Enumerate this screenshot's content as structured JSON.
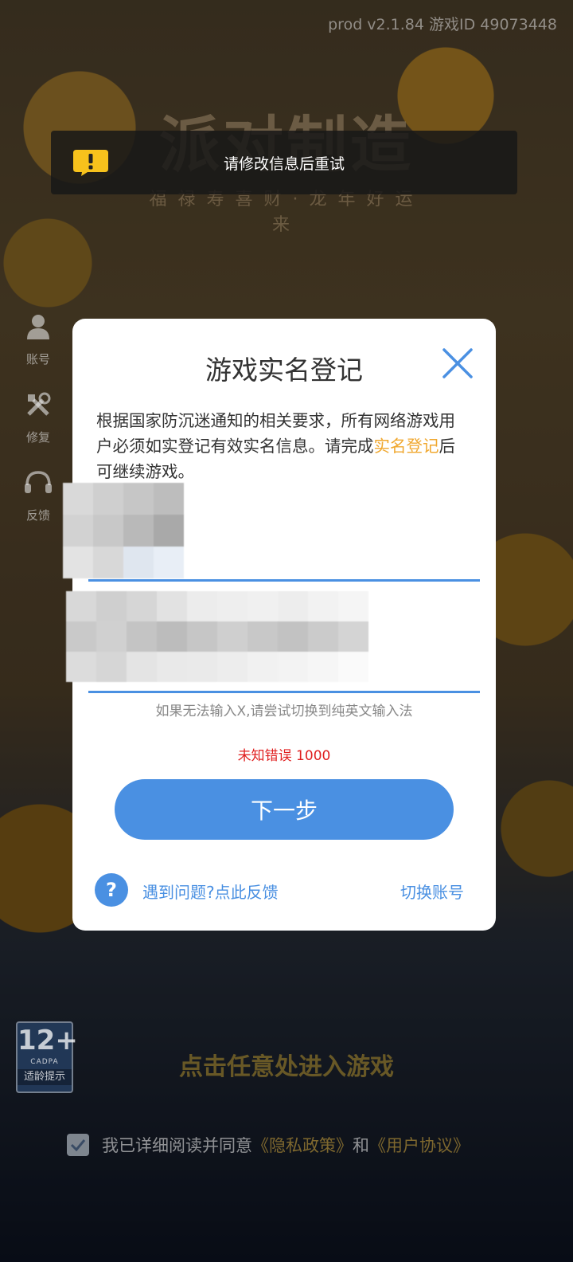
{
  "status": {
    "version": "prod v2.1.84 游戏ID 49073448"
  },
  "background": {
    "logo": "派对制造",
    "slogan": "福禄寿喜财·龙年好运来"
  },
  "side_menu": [
    {
      "label": "账号",
      "icon": "user-icon"
    },
    {
      "label": "修复",
      "icon": "tools-icon"
    },
    {
      "label": "反馈",
      "icon": "headset-icon"
    }
  ],
  "toast": {
    "icon": "warning-icon",
    "message": "请修改信息后重试"
  },
  "modal": {
    "title": "游戏实名登记",
    "desc_before": "根据国家防沉迷通知的相关要求，所有网络游戏用户必须如实登记有效实名信息。请完成",
    "desc_highlight": "实名登记",
    "desc_after": "后可继续游戏。",
    "field_id_label_visible": "号",
    "hint": "如果无法输入X,请尝试切换到纯英文输入法",
    "error": "未知错误 1000",
    "next_button": "下一步",
    "help_link": "遇到问题?点此反馈",
    "switch_account": "切换账号",
    "colors": {
      "accent": "#4a90e2",
      "highlight": "#f0a830",
      "error": "#e02020"
    }
  },
  "footer": {
    "age_rating": "12+",
    "age_org": "CADPA",
    "age_tip": "适龄提示",
    "enter_game": "点击任意处进入游戏",
    "agree_text": "我已详细阅读并同意",
    "privacy": "《隐私政策》",
    "and": "和",
    "user_agreement": "《用户协议》",
    "agreed": true
  }
}
